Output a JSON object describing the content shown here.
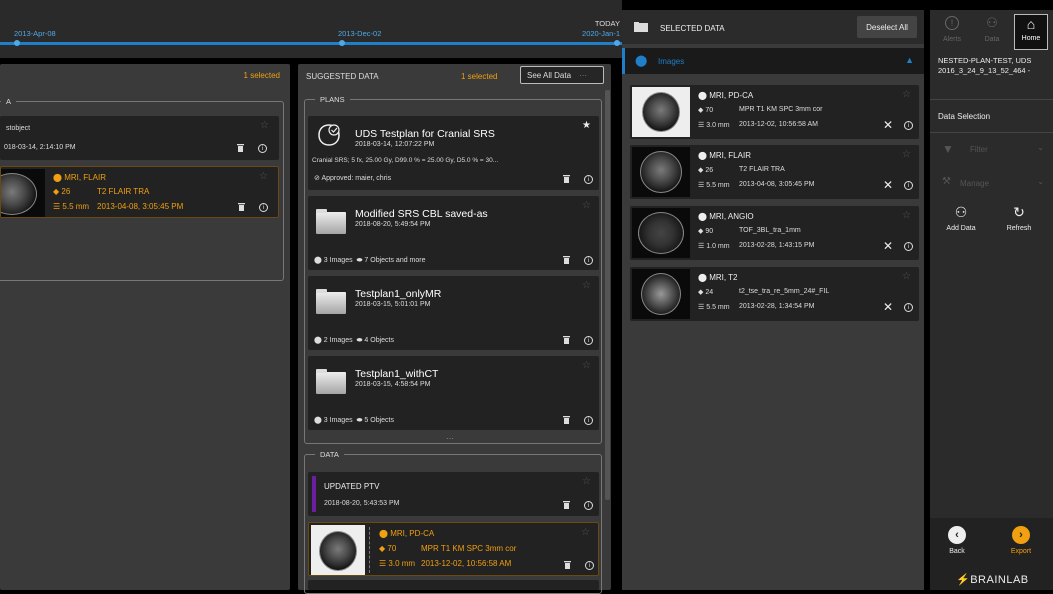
{
  "timeline": {
    "label1": "2013-Apr-08",
    "label2": "2013-Dec-02",
    "label3": "2020-Jan-1",
    "today": "TODAY"
  },
  "left": {
    "selected": "1 selected",
    "group": "A",
    "item1": {
      "name": "stobject",
      "date": "018-03-14, 2:14:10 PM"
    },
    "item2": {
      "modality": "MRI, FLAIR",
      "count": "26",
      "series": "T2 FLAIR TRA",
      "thick": "5.5 mm",
      "date": "2013-04-08, 3:05:45 PM"
    }
  },
  "suggested": {
    "title": "SUGGESTED DATA",
    "selected": "1 selected",
    "see_all": "See All Data",
    "plans_title": "PLANS",
    "data_title": "DATA",
    "plans": [
      {
        "name": "UDS Testplan for Cranial SRS",
        "date": "2018-03-14, 12:07:22 PM",
        "desc": "Cranial SRS; 5 fx, 25.00 Gy, D99.0 % = 25.00 Gy, D5.0 % = 30...",
        "approved": "Approved:  maier, chris"
      },
      {
        "name": "Modified SRS CBL saved-as",
        "date": "2018-08-20, 5:49:54 PM",
        "images": "3 Images",
        "objects": "7 Objects and more"
      },
      {
        "name": "Testplan1_onlyMR",
        "date": "2018-03-15, 5:01:01 PM",
        "images": "2 Images",
        "objects": "4 Objects"
      },
      {
        "name": "Testplan1_withCT",
        "date": "2018-03-15, 4:58:54 PM",
        "images": "3 Images",
        "objects": "5 Objects"
      }
    ],
    "data": [
      {
        "name": "UPDATED PTV",
        "date": "2018-08-20, 5:43:53 PM"
      },
      {
        "modality": "MRI, PD-CA",
        "count": "70",
        "series": "MPR T1 KM SPC 3mm cor",
        "thick": "3.0 mm",
        "date": "2013-12-02, 10:56:58 AM"
      }
    ]
  },
  "selected": {
    "title": "SELECTED DATA",
    "deselect": "Deselect All",
    "images": "Images",
    "items": [
      {
        "modality": "MRI, PD-CA",
        "count": "70",
        "series": "MPR T1 KM SPC 3mm cor",
        "thick": "3.0 mm",
        "date": "2013-12-02, 10:56:58 AM"
      },
      {
        "modality": "MRI, FLAIR",
        "count": "26",
        "series": "T2 FLAIR TRA",
        "thick": "5.5 mm",
        "date": "2013-04-08, 3:05:45 PM"
      },
      {
        "modality": "MRI, ANGIO",
        "count": "90",
        "series": "TOF_3BL_tra_1mm",
        "thick": "1.0 mm",
        "date": "2013-02-28, 1:43:15 PM"
      },
      {
        "modality": "MRI, T2",
        "count": "24",
        "series": "t2_tse_tra_re_5mm_24#_FIL",
        "thick": "5.5 mm",
        "date": "2013-02-28, 1:34:54 PM"
      }
    ]
  },
  "sidebar": {
    "alerts": "Alerts",
    "data": "Data",
    "home": "Home",
    "plan_name": "NESTED-PLAN-TEST, UDS 2016_3_24_9_13_52_464 -",
    "data_selection": "Data Selection",
    "filter": "Filter",
    "manage": "Manage",
    "add_data": "Add Data",
    "refresh": "Refresh",
    "back": "Back",
    "export": "Export",
    "brand": "BRAINLAB"
  },
  "colors": {
    "accent": "#1f7fc8",
    "orange": "#f0a010",
    "purple": "#6a1fa0"
  }
}
